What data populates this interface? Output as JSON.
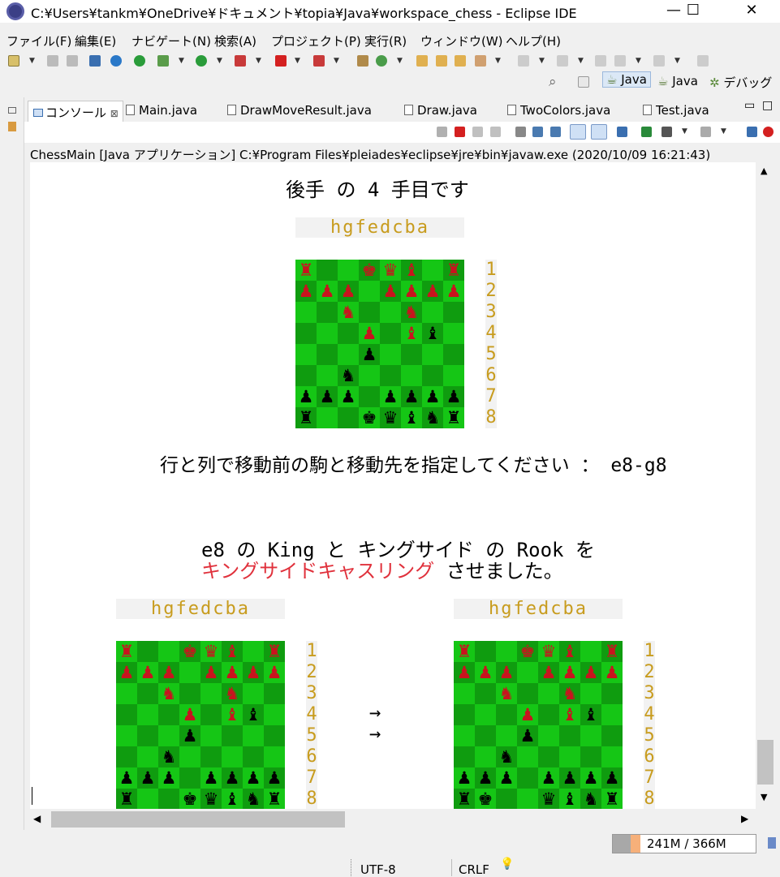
{
  "window": {
    "title": "C:¥Users¥tankm¥OneDrive¥ドキュメント¥topia¥Java¥workspace_chess - Eclipse IDE",
    "minimize": "—",
    "maximize": "☐",
    "close": "✕"
  },
  "menu": [
    "ファイル(F)",
    "編集(E)",
    "ナビゲート(N)",
    "検索(A)",
    "プロジェクト(P)",
    "実行(R)",
    "ウィンドウ(W)",
    "ヘルプ(H)"
  ],
  "perspectives": [
    {
      "label": "Java",
      "active": true
    },
    {
      "label": "Java",
      "active": false
    },
    {
      "label": "デバッグ",
      "active": false
    }
  ],
  "tabs": [
    {
      "label": "コンソール",
      "active": true
    },
    {
      "label": "Main.java",
      "active": false
    },
    {
      "label": "DrawMoveResult.java",
      "active": false
    },
    {
      "label": "Draw.java",
      "active": false
    },
    {
      "label": "TwoColors.java",
      "active": false
    },
    {
      "label": "Test.java",
      "active": false
    }
  ],
  "tab_close": "⊠",
  "console_header": "ChessMain [Java アプリケーション] C:¥Program Files¥pleiades¥eclipse¥jre¥bin¥javaw.exe  (2020/10/09 16:21:43)",
  "console": {
    "turn_line": "後手 の 4 手目です",
    "files": "hgfedcba",
    "ranks": [
      "1",
      "2",
      "3",
      "4",
      "5",
      "6",
      "7",
      "8"
    ],
    "prompt": "行と列で移動前の駒と移動先を指定してください ： e8-g8",
    "result_line1": "e8 の King と キングサイド の Rook を",
    "result_highlight": "キングサイドキャスリング",
    "result_rest": " させました。",
    "arrows": [
      "→",
      "→"
    ],
    "board_before": [
      [
        "r♜",
        "",
        "",
        "r♚",
        "r♛",
        "r♝",
        "",
        "r♜"
      ],
      [
        "r♟",
        "r♟",
        "r♟",
        "",
        "r♟",
        "r♟",
        "r♟",
        "r♟"
      ],
      [
        "",
        "",
        "r♞",
        "",
        "",
        "r♞",
        "",
        ""
      ],
      [
        "",
        "",
        "",
        "r♟",
        "",
        "r♝",
        "b♝",
        ""
      ],
      [
        "",
        "",
        "",
        "b♟",
        "",
        "",
        "",
        ""
      ],
      [
        "",
        "",
        "b♞",
        "",
        "",
        "",
        "",
        ""
      ],
      [
        "b♟",
        "b♟",
        "b♟",
        "",
        "b♟",
        "b♟",
        "b♟",
        "b♟"
      ],
      [
        "b♜",
        "",
        "",
        "b♚",
        "b♛",
        "b♝",
        "b♞",
        "b♜"
      ]
    ],
    "board_after": [
      [
        "r♜",
        "",
        "",
        "r♚",
        "r♛",
        "r♝",
        "",
        "r♜"
      ],
      [
        "r♟",
        "r♟",
        "r♟",
        "",
        "r♟",
        "r♟",
        "r♟",
        "r♟"
      ],
      [
        "",
        "",
        "r♞",
        "",
        "",
        "r♞",
        "",
        ""
      ],
      [
        "",
        "",
        "",
        "r♟",
        "",
        "r♝",
        "b♝",
        ""
      ],
      [
        "",
        "",
        "",
        "b♟",
        "",
        "",
        "",
        ""
      ],
      [
        "",
        "",
        "b♞",
        "",
        "",
        "",
        "",
        ""
      ],
      [
        "b♟",
        "b♟",
        "b♟",
        "",
        "b♟",
        "b♟",
        "b♟",
        "b♟"
      ],
      [
        "b♜",
        "b♚",
        "",
        "",
        "b♛",
        "b♝",
        "b♞",
        "b♜"
      ]
    ]
  },
  "status": {
    "memory": "241M / 366M",
    "encoding": "UTF-8",
    "line_ending": "CRLF"
  },
  "colors": {
    "light_square": "#15c615",
    "dark_square": "#0f9c0f",
    "red_piece": "#c8141e",
    "label_gold": "#c89c1e",
    "highlight_red": "#e0313c"
  }
}
